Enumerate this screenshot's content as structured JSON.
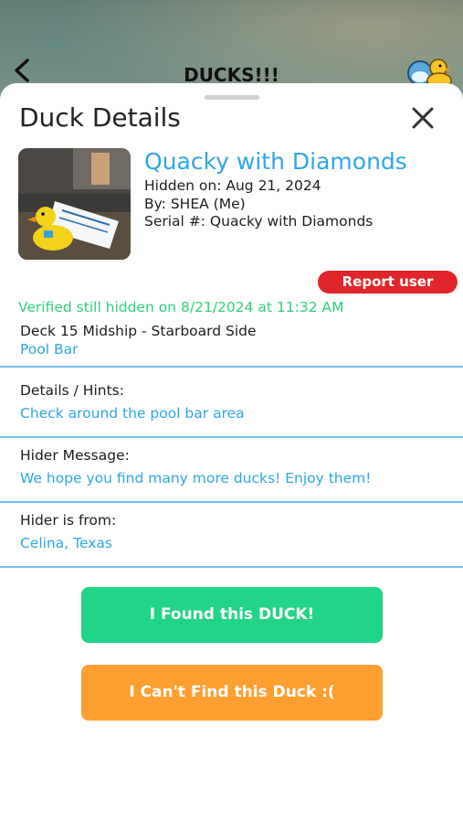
{
  "app_header": {
    "title": "DUCKS!!!",
    "icons": {
      "back": "chevron-left-icon",
      "logo": "duck-logo-icon"
    }
  },
  "sheet": {
    "title": "Duck Details",
    "icons": {
      "close": "close-icon"
    }
  },
  "duck": {
    "photo_icon": "duck-photo",
    "name": "Quacky with Diamonds",
    "hidden_on": "Hidden on: Aug 21, 2024",
    "by": "By: SHEA (Me)",
    "serial": "Serial #: Quacky with Diamonds"
  },
  "report_button": "Report user",
  "status": {
    "verified": "Verified still hidden on  8/21/2024  at  11:32 AM"
  },
  "location": {
    "deck": "Deck  15  Midship - Starboard Side",
    "venue": "Pool Bar"
  },
  "sections": [
    {
      "label": "Details / Hints:",
      "value": "Check around the pool bar area"
    },
    {
      "label": "Hider Message:",
      "value": "We hope you find many more ducks! Enjoy them!"
    },
    {
      "label": "Hider is from:",
      "value": "Celina, Texas"
    }
  ],
  "actions": {
    "found": "I Found this DUCK!",
    "cant_find": "I Can't Find this Duck :("
  },
  "colors": {
    "accent_blue": "#2ea6e6",
    "verified_green": "#2ecf7a",
    "found_button": "#22d487",
    "cant_find_button": "#ff9f30",
    "report_red": "#e0262b"
  }
}
